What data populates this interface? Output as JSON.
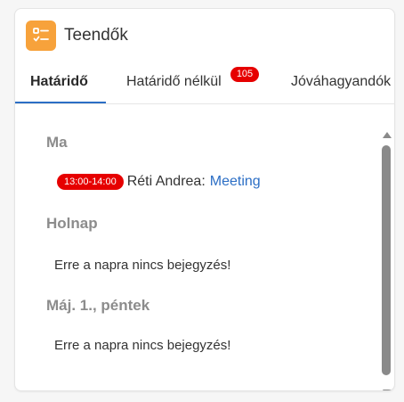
{
  "app": {
    "title": "Teendők",
    "icon": "checklist-icon",
    "icon_color": "#f7a23b"
  },
  "tabs": [
    {
      "label": "Határidő",
      "active": true
    },
    {
      "label": "Határidő nélkül",
      "badge": "105"
    },
    {
      "label": "Jóváhagyandók"
    }
  ],
  "sections": [
    {
      "title": "Ma",
      "entry": {
        "time": "13:00-14:00",
        "person": "Réti Andrea:",
        "link": "Meeting"
      }
    },
    {
      "title": "Holnap",
      "empty": "Erre a napra nincs bejegyzés!"
    },
    {
      "title": "Máj. 1., péntek",
      "empty": "Erre a napra nincs bejegyzés!"
    }
  ],
  "colors": {
    "accent": "#2b6ec5",
    "badge": "#e60000",
    "section_title": "#8c8c8c"
  }
}
